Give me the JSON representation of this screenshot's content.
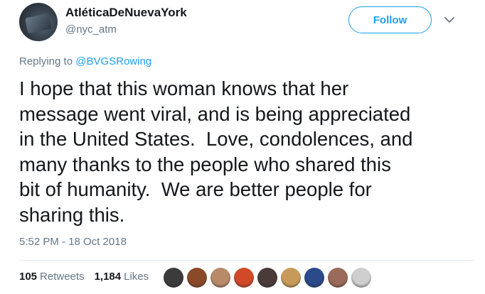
{
  "user": {
    "display_name": "AtléticaDeNuevaYork",
    "handle": "@nyc_atm"
  },
  "follow_button": {
    "label": "Follow"
  },
  "reply_context": {
    "prefix": "Replying to ",
    "mention": "@BVGSRowing"
  },
  "tweet": {
    "text": "I hope that this woman knows that her\nmessage went viral, and is being appreciated\nin the United States.  Love, condolences, and\nmany thanks to the people who shared this\nbit of humanity.  We are better people for\nsharing this.",
    "timestamp": "5:52 PM - 18 Oct 2018"
  },
  "stats": {
    "retweets": {
      "count": "105",
      "label": "Retweets"
    },
    "likes": {
      "count": "1,184",
      "label": "Likes"
    }
  },
  "likers": [
    {
      "color": "#3b3b3b"
    },
    {
      "color": "#8a4a2a"
    },
    {
      "color": "#b88a6a"
    },
    {
      "color": "#d04a2a"
    },
    {
      "color": "#4a3a3a"
    },
    {
      "color": "#c89a5a"
    },
    {
      "color": "#2a4a8a"
    },
    {
      "color": "#9a6a5a"
    },
    {
      "color": "#cfcfcf"
    }
  ],
  "colors": {
    "accent": "#1da1f2",
    "secondary_text": "#657786",
    "primary_text": "#14171a"
  }
}
